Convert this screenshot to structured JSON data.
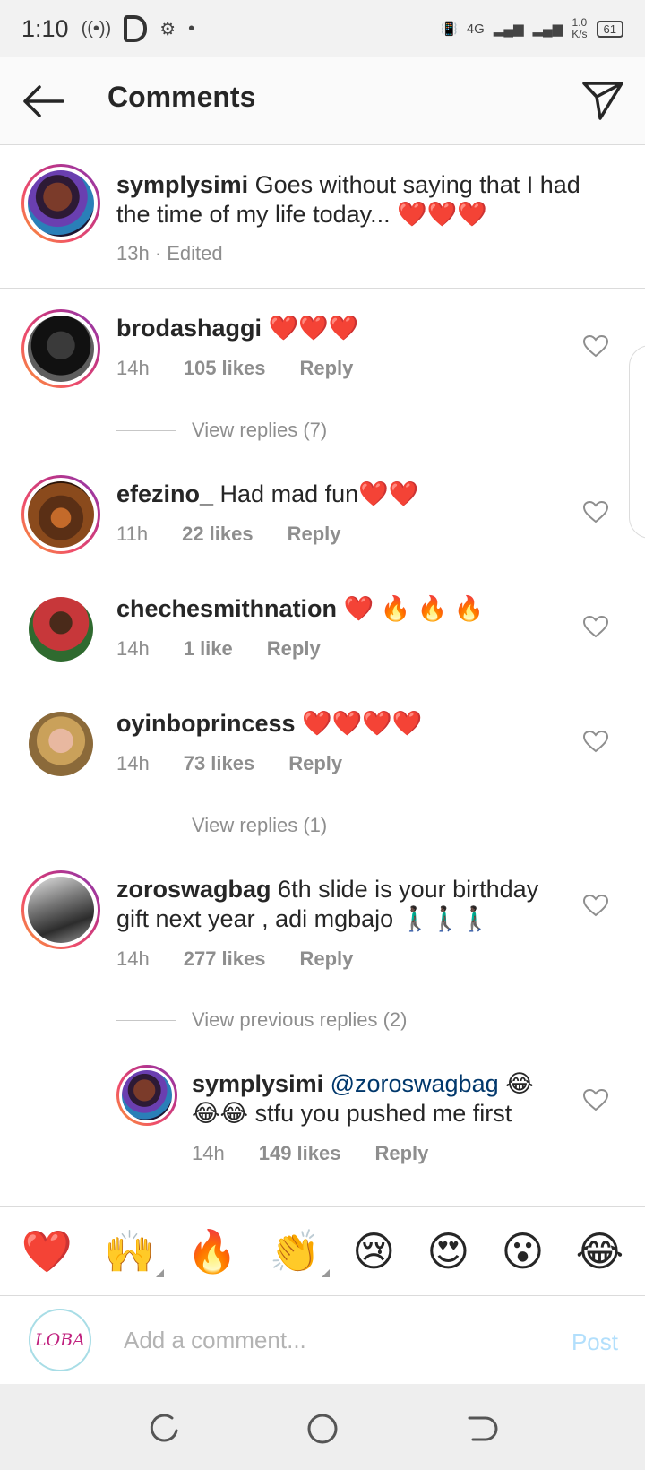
{
  "status_bar": {
    "time": "1:10",
    "network": "4G",
    "speed": "1.0\nK/s",
    "battery": "61"
  },
  "header": {
    "title": "Comments"
  },
  "caption": {
    "username": "symplysimi",
    "text": "Goes without saying that I had the time of my life today...",
    "hearts": "❤️❤️❤️",
    "time": "13h · Edited"
  },
  "comments": [
    {
      "username": "brodashaggi",
      "text": "",
      "emoji": "❤️❤️❤️",
      "time": "14h",
      "likes": "105 likes",
      "reply": "Reply",
      "view_replies": "View replies (7)"
    },
    {
      "username": "efezino_",
      "text": "Had mad fun",
      "emoji": "❤️❤️",
      "time": "11h",
      "likes": "22 likes",
      "reply": "Reply"
    },
    {
      "username": "chechesmithnation",
      "text": "",
      "emoji": "❤️ 🔥 🔥 🔥",
      "time": "14h",
      "likes": "1 like",
      "reply": "Reply"
    },
    {
      "username": "oyinboprincess",
      "text": "",
      "emoji": "❤️❤️❤️❤️",
      "time": "14h",
      "likes": "73 likes",
      "reply": "Reply",
      "view_replies": "View replies (1)"
    },
    {
      "username": "zoroswagbag",
      "text": "6th slide is your birthday gift next year , adi mgbajo",
      "emoji": "🚶🏿‍♂️🚶🏿‍♂️🚶🏿‍♂️",
      "time": "14h",
      "likes": "277 likes",
      "reply": "Reply",
      "view_replies": "View previous replies (2)"
    }
  ],
  "reply": {
    "username": "symplysimi",
    "mention": "@zoroswagbag",
    "emoji_1": "😂",
    "emoji_2": "😂😂",
    "text": "stfu you pushed me first",
    "time": "14h",
    "likes": "149 likes",
    "reply": "Reply"
  },
  "emoji_bar": [
    "❤️",
    "🙌",
    "🔥",
    "👏",
    "😢",
    "😍",
    "😮",
    "😂"
  ],
  "input": {
    "avatar_text": "LOBA",
    "placeholder": "Add a comment...",
    "post_label": "Post"
  },
  "colors": {
    "username": "#262626",
    "meta": "#8e8e8e",
    "heart": "#e0202a",
    "post_disabled": "#b2dffc"
  }
}
